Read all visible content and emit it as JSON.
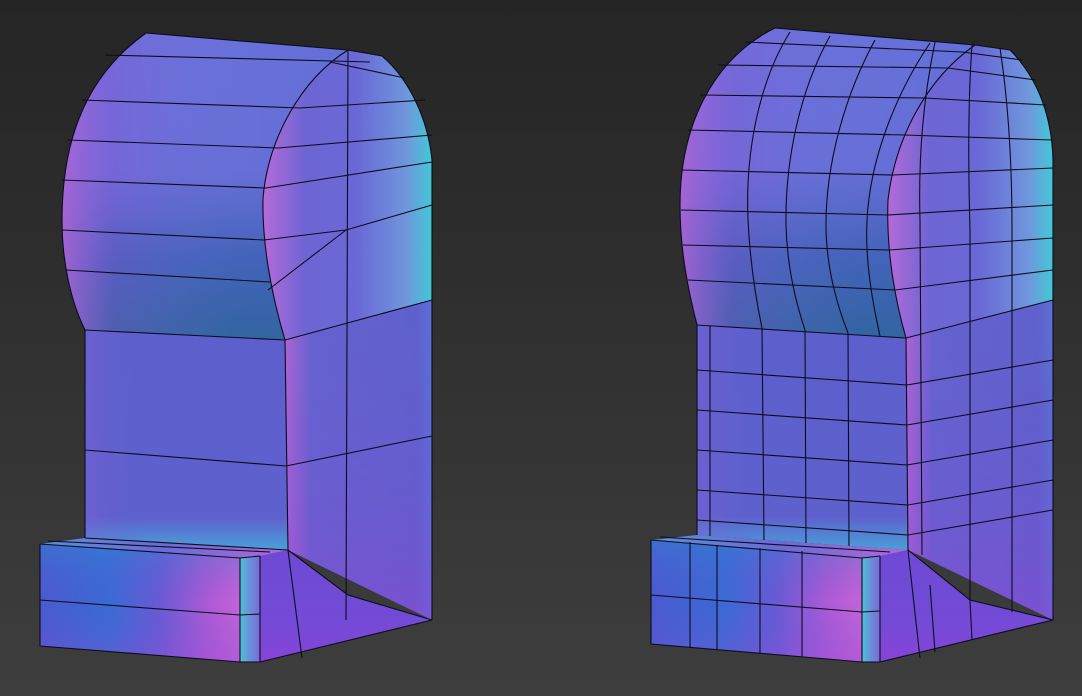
{
  "scene": {
    "background_colors": [
      "#252525",
      "#3e3e3e"
    ],
    "models": [
      {
        "name": "low-poly-model",
        "wireframe": "sparse"
      },
      {
        "name": "subdivided-model",
        "wireframe": "dense"
      }
    ],
    "shading": {
      "base": "#6262cf",
      "highlight_pink": "#b266d6",
      "highlight_cyan": "#40c6d8",
      "shadow_teal": "#2a5c9e",
      "wire": "#0c0c1e"
    }
  }
}
